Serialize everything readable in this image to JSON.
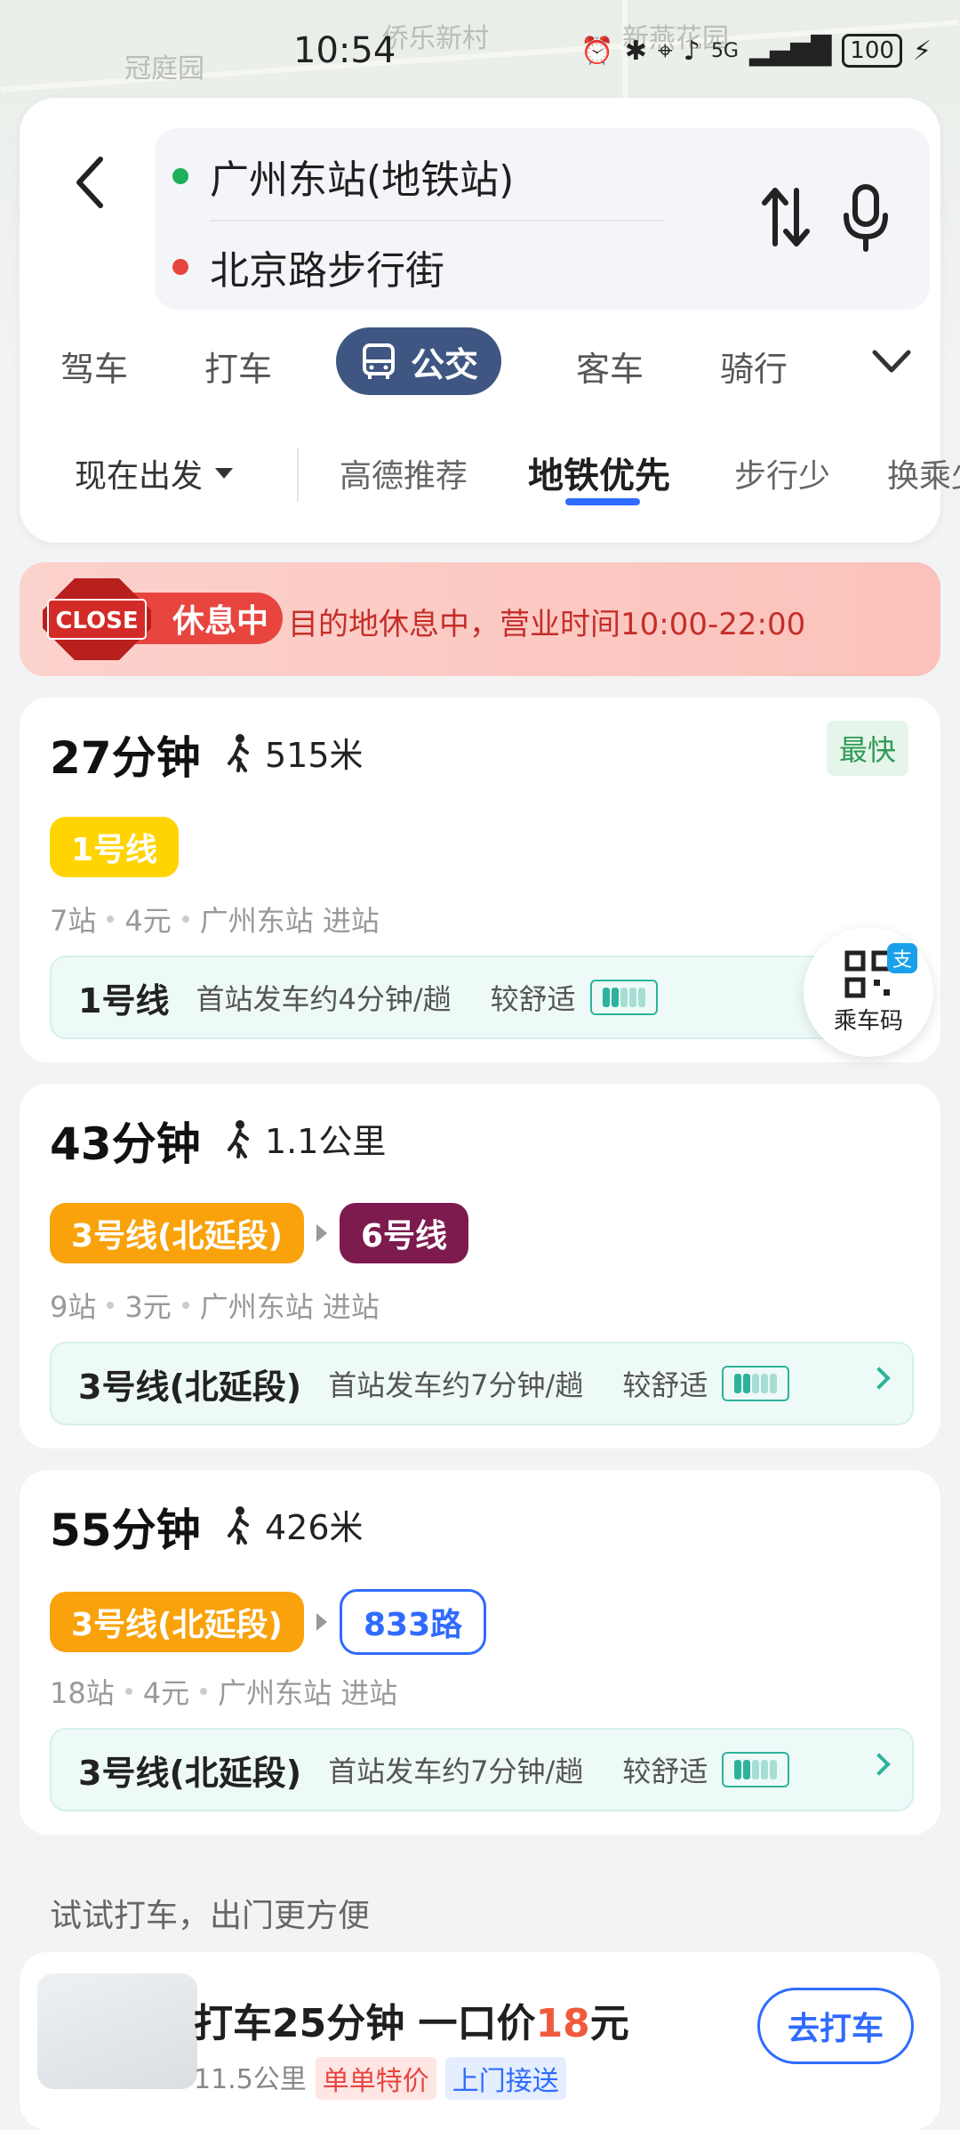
{
  "status_bar": {
    "time": "10:54",
    "network": "5G",
    "battery": "100",
    "map_labels": [
      "冠庭园",
      "侨乐新村",
      "新燕花园"
    ]
  },
  "route": {
    "from": "广州东站(地铁站)",
    "to": "北京路步行街",
    "from_color": "#1eb05a",
    "to_color": "#e8453f"
  },
  "mode_tabs": [
    {
      "label": "驾车"
    },
    {
      "label": "打车"
    },
    {
      "label": "公交",
      "active": true
    },
    {
      "label": "客车"
    },
    {
      "label": "骑行"
    }
  ],
  "filters": {
    "depart": "现在出发",
    "options": [
      "高德推荐",
      "地铁优先",
      "步行少",
      "换乘少"
    ],
    "active": "地铁优先"
  },
  "closed_banner": {
    "sign": "CLOSE",
    "status": "休息中",
    "text": "目的地休息中，营业时间10:00-22:00"
  },
  "routes": [
    {
      "time": "27分钟",
      "walk": "515米",
      "badge": "最快",
      "lines": [
        {
          "name": "1号线",
          "color": "#ffd400"
        }
      ],
      "stations": "7站",
      "price": "4元",
      "entry": "广州东站 进站",
      "detail_line": "1号线",
      "frequency": "首站发车约4分钟/趟",
      "comfort": "较舒适"
    },
    {
      "time": "43分钟",
      "walk": "1.1公里",
      "lines": [
        {
          "name": "3号线(北延段)",
          "color": "#f9a20b"
        },
        {
          "name": "6号线",
          "color": "#7d1b4f"
        }
      ],
      "stations": "9站",
      "price": "3元",
      "entry": "广州东站 进站",
      "detail_line": "3号线(北延段)",
      "frequency": "首站发车约7分钟/趟",
      "comfort": "较舒适"
    },
    {
      "time": "55分钟",
      "walk": "426米",
      "lines": [
        {
          "name": "3号线(北延段)",
          "color": "#f9a20b"
        },
        {
          "name": "833路",
          "color": "#2f6bff"
        }
      ],
      "stations": "18站",
      "price": "4元",
      "entry": "广州东站 进站",
      "detail_line": "3号线(北延段)",
      "frequency": "首站发车约7分钟/趟",
      "comfort": "较舒适"
    }
  ],
  "qr_button": {
    "label": "乘车码",
    "badge": "支"
  },
  "taxi": {
    "hint": "试试打车，出门更方便",
    "title_prefix": "打车25分钟 一口价",
    "price": "18",
    "title_suffix": "元",
    "distance": "11.5公里",
    "tag1": "单单特价",
    "tag2": "上门接送",
    "button": "去打车"
  }
}
